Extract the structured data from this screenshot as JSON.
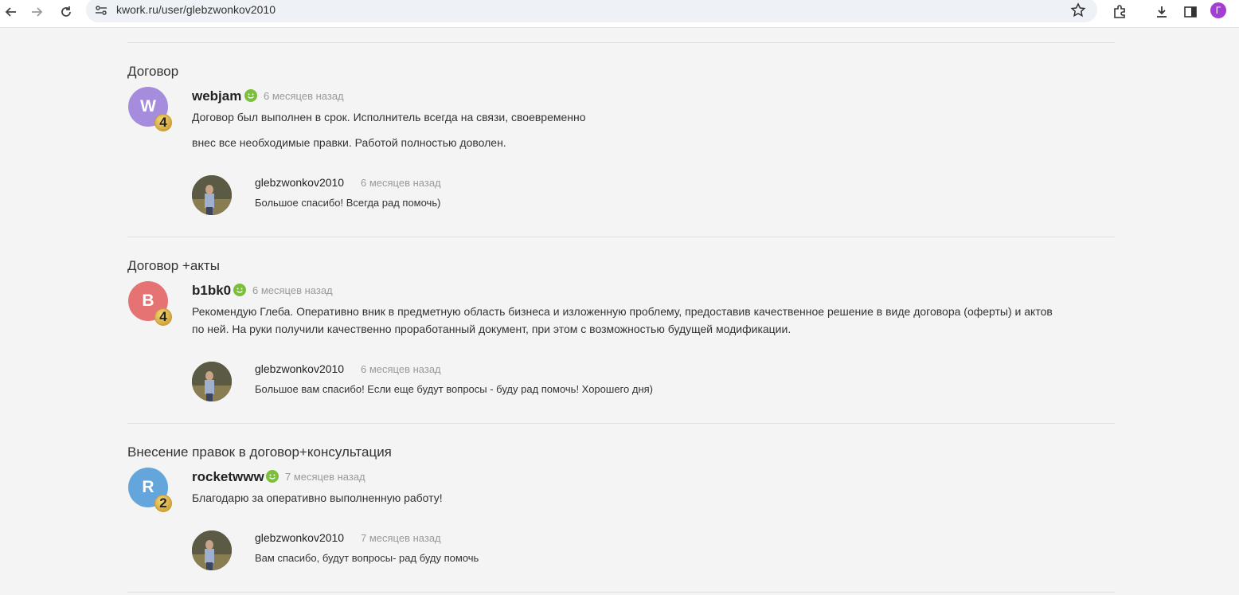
{
  "browser": {
    "url": "kwork.ru/user/glebzwonkov2010",
    "profile_initial": "Г",
    "icons": [
      "back-icon",
      "forward-icon",
      "reload-icon",
      "site-settings-icon",
      "bookmark-star-icon",
      "extensions-icon",
      "download-icon",
      "sidebar-icon"
    ]
  },
  "reviews": [
    {
      "title": "Договор",
      "avatar_letter": "W",
      "avatar_color": "#a58cdc",
      "level": "4",
      "username": "webjam",
      "time": "6 месяцев назад",
      "text_lines": [
        "Договор был выполнен в срок. Исполнитель всегда на связи, своевременно",
        "внес все необходимые правки. Работой полностью доволен."
      ],
      "reply": {
        "name": "glebzwonkov2010",
        "time": "6 месяцев назад",
        "text": "Большое спасибо! Всегда рад помочь)"
      }
    },
    {
      "title": "Договор +акты",
      "avatar_letter": "B",
      "avatar_color": "#e57373",
      "level": "4",
      "username": "b1bk0",
      "time": "6 месяцев назад",
      "text_lines": [
        "Рекомендую Глеба. Оперативно вник в предметную область бизнеса и изложенную проблему, предоставив качественное решение в виде договора (оферты) и актов",
        "по ней. На руки получили качественно проработанный документ, при этом с возможностью будущей модификации."
      ],
      "reply": {
        "name": "glebzwonkov2010",
        "time": "6 месяцев назад",
        "text": "Большое вам спасибо! Если еще будут вопросы - буду рад помочь! Хорошего дня)"
      }
    },
    {
      "title": "Внесение правок в договор+консультация",
      "avatar_letter": "R",
      "avatar_color": "#64a6dc",
      "level": "2",
      "username": "rocketwww",
      "time": "7 месяцев назад",
      "text_lines": [
        "Благодарю за оперативно выполненную работу!"
      ],
      "reply": {
        "name": "glebzwonkov2010",
        "time": "7 месяцев назад",
        "text": "Вам спасибо, будут вопросы- рад буду помочь"
      }
    }
  ]
}
